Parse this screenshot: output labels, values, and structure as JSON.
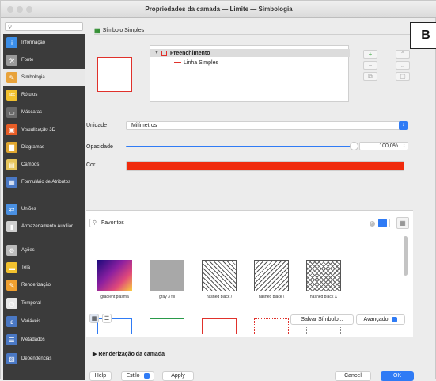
{
  "window": {
    "title": "Propriedades da camada — Limite — Simbologia"
  },
  "sidebar": {
    "items": [
      {
        "label": "Informação",
        "icon": "info-icon",
        "color": "#3b8ee8",
        "glyph": "i"
      },
      {
        "label": "Fonte",
        "icon": "source-icon",
        "color": "#9a9a9a",
        "glyph": "⚒"
      },
      {
        "label": "Simbologia",
        "icon": "symbology-icon",
        "color": "#e8a23a",
        "glyph": "✎"
      },
      {
        "label": "Rótulos",
        "icon": "labels-icon",
        "color": "#f2c12e",
        "glyph": "abc"
      },
      {
        "label": "Máscaras",
        "icon": "masks-icon",
        "color": "#6a6a6a",
        "glyph": "▭"
      },
      {
        "label": "Visualização 3D",
        "icon": "3d-view-icon",
        "color": "#e85d26",
        "glyph": "▣"
      },
      {
        "label": "Diagramas",
        "icon": "diagrams-icon",
        "color": "#e0a730",
        "glyph": "▇"
      },
      {
        "label": "Campos",
        "icon": "fields-icon",
        "color": "#e6c55a",
        "glyph": "▤"
      },
      {
        "label": "Formulário de Atributos",
        "icon": "attribute-form-icon",
        "color": "#4a78c4",
        "glyph": "▦"
      },
      {
        "label": "Uniões",
        "icon": "joins-icon",
        "color": "#4a90e2",
        "glyph": "⇄"
      },
      {
        "label": "Armazenamento Auxiliar",
        "icon": "auxiliary-storage-icon",
        "color": "#cfcfcf",
        "glyph": "▮"
      },
      {
        "label": "Ações",
        "icon": "actions-icon",
        "color": "#bbbbbb",
        "glyph": "⚙"
      },
      {
        "label": "Tela",
        "icon": "display-icon",
        "color": "#f2c12e",
        "glyph": "▬"
      },
      {
        "label": "Renderização",
        "icon": "rendering-icon",
        "color": "#f0a030",
        "glyph": "✎"
      },
      {
        "label": "Temporal",
        "icon": "temporal-icon",
        "color": "#e8e8e8",
        "glyph": "◷"
      },
      {
        "label": "Variáveis",
        "icon": "variables-icon",
        "color": "#4a78c4",
        "glyph": "ε"
      },
      {
        "label": "Metadados",
        "icon": "metadata-icon",
        "color": "#4a78c4",
        "glyph": "☰"
      },
      {
        "label": "Dependências",
        "icon": "dependencies-icon",
        "color": "#4a78c4",
        "glyph": "▧"
      }
    ]
  },
  "symbol_tab": {
    "label": "Símbolo Simples"
  },
  "badge": {
    "label": "B"
  },
  "tree": {
    "fill_label": "Preenchimento",
    "line_label": "Linha Simples"
  },
  "unit": {
    "label": "Unidade",
    "value": "Milímetros"
  },
  "opacity": {
    "label": "Opacidade",
    "value": "100,0%",
    "level": 1.0
  },
  "color": {
    "label": "Cor",
    "value": "#f02a0c"
  },
  "library": {
    "search_value": "Favoritos",
    "symbols": [
      {
        "caption": "gradient  plasma",
        "kind": "gradient-plasma"
      },
      {
        "caption": "gray 3 fill",
        "kind": "gray"
      },
      {
        "caption": "hashed black /",
        "kind": "hatch-slash"
      },
      {
        "caption": "hashed black \\",
        "kind": "hatch-back"
      },
      {
        "caption": "hashed black X",
        "kind": "hatch-x"
      }
    ],
    "save_label": "Salvar Símbolo...",
    "advanced_label": "Avançado"
  },
  "render_section": {
    "label": "Renderização da camada"
  },
  "footer": {
    "help_label": "Help",
    "style_label": "Estilo",
    "apply_label": "Apply",
    "cancel_label": "Cancel",
    "ok_label": "OK"
  },
  "colors": {
    "accent": "#2f7bf5",
    "symbol_red": "#e0312b"
  }
}
